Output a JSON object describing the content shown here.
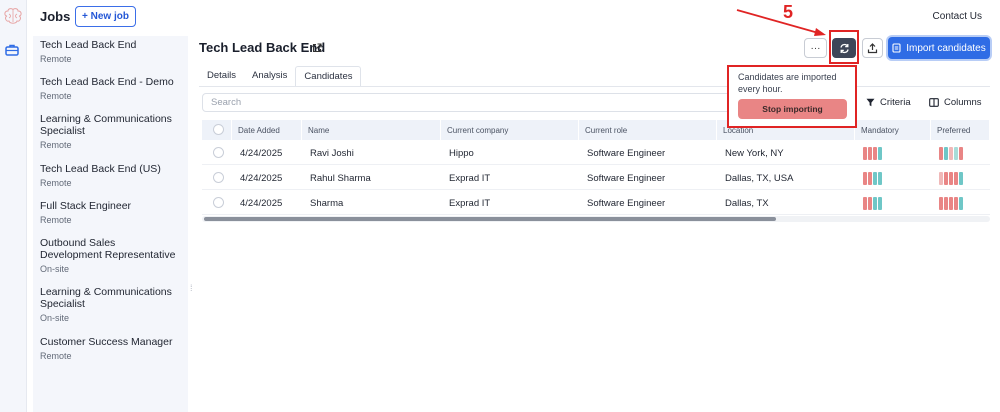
{
  "header": {
    "jobs_title": "Jobs",
    "new_job_label": "+ New job",
    "contact_label": "Contact Us"
  },
  "sidebar": {
    "jobs": [
      {
        "title": "Tech Lead Back End",
        "location": "Remote"
      },
      {
        "title": "Tech Lead Back End - Demo",
        "location": "Remote"
      },
      {
        "title": "Learning & Communications Specialist",
        "location": "Remote"
      },
      {
        "title": "Tech Lead Back End (US)",
        "location": "Remote"
      },
      {
        "title": "Full Stack Engineer",
        "location": "Remote"
      },
      {
        "title": "Outbound Sales Development Representative",
        "location": "On-site"
      },
      {
        "title": "Learning & Communications Specialist",
        "location": "On-site"
      },
      {
        "title": "Customer Success Manager",
        "location": "Remote"
      }
    ]
  },
  "main": {
    "title": "Tech Lead Back End",
    "more_label": "···",
    "import_label": "Import candidates",
    "tabs": [
      "Details",
      "Analysis",
      "Candidates"
    ],
    "active_tab": "Candidates",
    "search_placeholder": "Search",
    "criteria_label": "Criteria",
    "columns_label": "Columns"
  },
  "popover": {
    "message": "Candidates are imported every hour.",
    "stop_label": "Stop importing"
  },
  "annotation": {
    "step": "5"
  },
  "table": {
    "columns": [
      "Date Added",
      "Name",
      "Current company",
      "Current role",
      "Location",
      "Mandatory",
      "Preferred"
    ],
    "rows": [
      {
        "date": "4/24/2025",
        "name": "Ravi Joshi",
        "company": "Hippo",
        "role": "Software Engineer",
        "location": "New York, NY",
        "mandatory": [
          "#e98585",
          "#e98585",
          "#e98585",
          "#6fc7c7"
        ],
        "preferred": [
          "#e98585",
          "#6fc7c7",
          "#f0b8b8",
          "#a8dcd8",
          "#e98585"
        ]
      },
      {
        "date": "4/24/2025",
        "name": "Rahul Sharma",
        "company": "Exprad IT",
        "role": "Software Engineer",
        "location": "Dallas, TX, USA",
        "mandatory": [
          "#e98585",
          "#e98585",
          "#6fc7c7",
          "#6fc7c7"
        ],
        "preferred": [
          "#f0b8b8",
          "#e98585",
          "#e98585",
          "#e98585",
          "#6fc7c7"
        ]
      },
      {
        "date": "4/24/2025",
        "name": "Sharma",
        "company": "Exprad IT",
        "role": "Software Engineer",
        "location": "Dallas, TX",
        "mandatory": [
          "#e98585",
          "#e98585",
          "#6fc7c7",
          "#6fc7c7"
        ],
        "preferred": [
          "#e98585",
          "#e98585",
          "#e98585",
          "#e98585",
          "#6fc7c7"
        ]
      }
    ]
  },
  "colors": {
    "accent": "#2f6ce5",
    "annotation_red": "#e02424",
    "stop_button": "#e98585"
  }
}
